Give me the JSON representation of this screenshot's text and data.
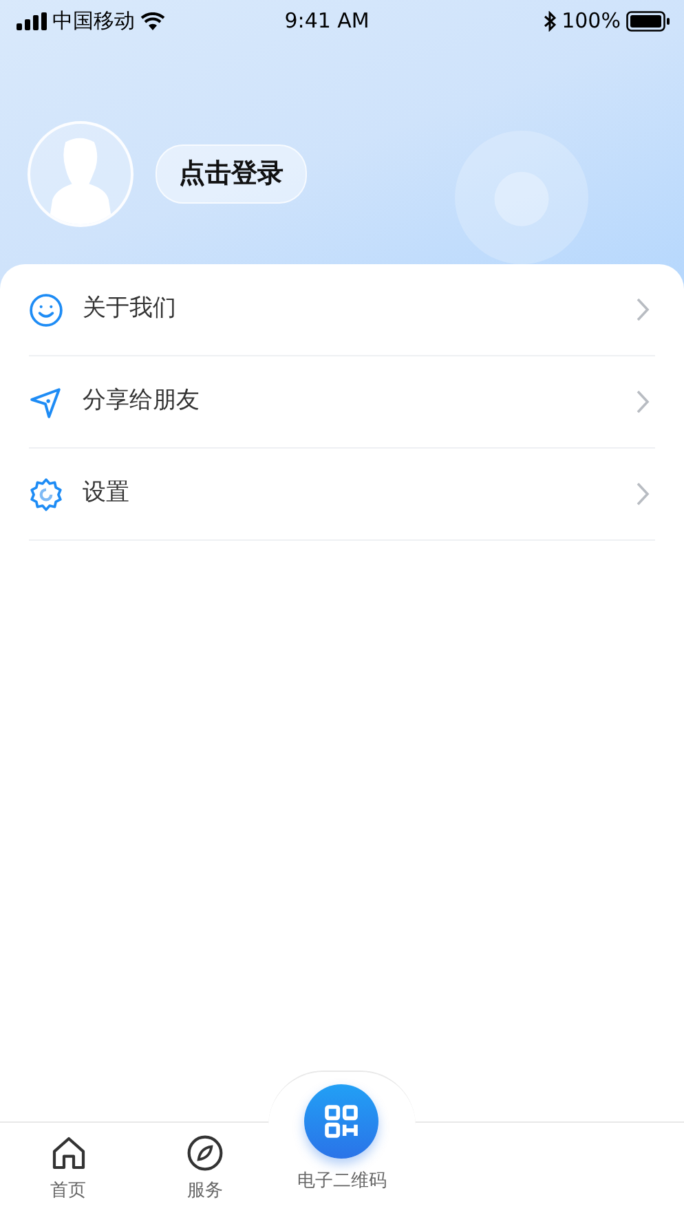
{
  "status_bar": {
    "carrier": "中国移动",
    "time": "9:41 AM",
    "battery": "100%"
  },
  "profile": {
    "login_button": "点击登录"
  },
  "menu": [
    {
      "label": "关于我们"
    },
    {
      "label": "分享给朋友"
    },
    {
      "label": "设置"
    }
  ],
  "tab_bar": [
    {
      "kind": "tab",
      "label": "首页",
      "selected": false
    },
    {
      "kind": "tab",
      "label": "服务",
      "selected": false
    },
    {
      "kind": "center",
      "label": "电子二维码",
      "selected": false
    }
  ]
}
